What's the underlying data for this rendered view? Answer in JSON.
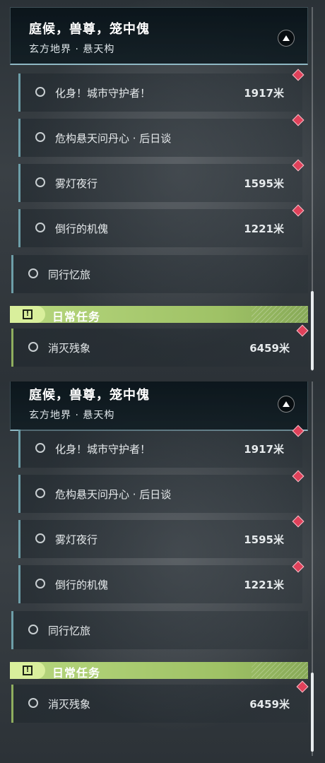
{
  "header": {
    "title": "庭候，兽尊，笼中傀",
    "location": "玄方地界 · 悬天构"
  },
  "quests": [
    {
      "name": "化身！城市守护者！",
      "distance": "1917米"
    },
    {
      "name": "危构悬天问丹心 · 后日谈",
      "distance": ""
    },
    {
      "name": "雾灯夜行",
      "distance": "1595米"
    },
    {
      "name": "倒行的机傀",
      "distance": "1221米"
    }
  ],
  "companion": {
    "name": "同行忆旅"
  },
  "daily": {
    "label": "日常任务",
    "quest": {
      "name": "消灭残象",
      "distance": "6459米"
    }
  },
  "colors": {
    "accent_line": "#6d9ea8",
    "daily_green": "#b7d77e",
    "marker_red": "#e0415a"
  },
  "icons": {
    "collapse": "chevron-up-icon",
    "quest_status": "circle-icon",
    "map_marker": "diamond-marker-icon",
    "daily_badge": "exclamation-icon"
  }
}
